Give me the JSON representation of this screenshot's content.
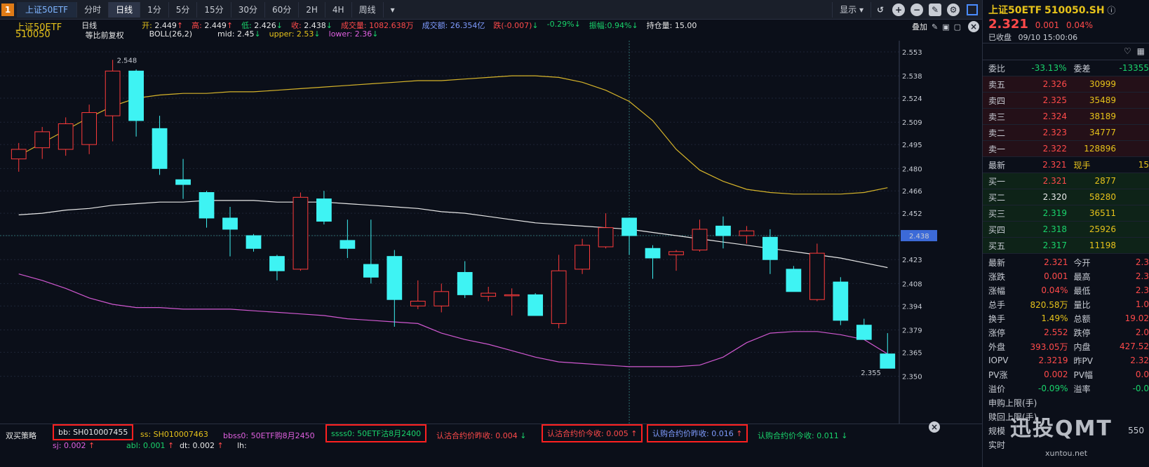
{
  "toolbar": {
    "badge": "1",
    "symbol_tab": "上证50ETF",
    "tabs": [
      "分时",
      "日线",
      "1分",
      "5分",
      "15分",
      "30分",
      "60分",
      "2H",
      "4H",
      "周线"
    ],
    "active_tab": "日线",
    "display_label": "显示"
  },
  "header": {
    "name": "上证50ETF",
    "code": "510050",
    "period": "日线",
    "adjust": "等比前复权",
    "indicator": "BOLL(26,2)",
    "open_label": "开:",
    "open": "2.449",
    "high_label": "高:",
    "high": "2.449",
    "low_label": "低:",
    "low": "2.426",
    "close_label": "收:",
    "close": "2.438",
    "vol_label": "成交量:",
    "vol": "1082.638万",
    "amt_label": "成交额:",
    "amt": "26.354亿",
    "chg_label": "跌(-0.007)",
    "chg_pct": "-0.29%",
    "amp_label": "振幅:0.94%",
    "oi_label": "持仓量:",
    "oi": "15.00",
    "mid_label": "mid:",
    "mid": "2.45",
    "upper_label": "upper:",
    "upper": "2.53",
    "lower_label": "lower:",
    "lower": "2.36",
    "overlay": "叠加"
  },
  "chart_data": {
    "type": "candlestick",
    "ylim": [
      2.345,
      2.56
    ],
    "yticks": [
      "2.553",
      "2.538",
      "2.524",
      "2.509",
      "2.495",
      "2.480",
      "2.466",
      "2.452",
      "2.438",
      "2.423",
      "2.408",
      "2.394",
      "2.379",
      "2.365",
      "2.350"
    ],
    "current_price_tag": "2.438",
    "max_label": "2.548",
    "min_label": "2.355",
    "candles": [
      {
        "o": 2.486,
        "h": 2.496,
        "l": 2.478,
        "c": 2.492
      },
      {
        "o": 2.493,
        "h": 2.506,
        "l": 2.486,
        "c": 2.503
      },
      {
        "o": 2.492,
        "h": 2.512,
        "l": 2.488,
        "c": 2.508
      },
      {
        "o": 2.495,
        "h": 2.52,
        "l": 2.489,
        "c": 2.515
      },
      {
        "o": 2.513,
        "h": 2.548,
        "l": 2.497,
        "c": 2.541
      },
      {
        "o": 2.541,
        "h": 2.542,
        "l": 2.5,
        "c": 2.51
      },
      {
        "o": 2.505,
        "h": 2.513,
        "l": 2.476,
        "c": 2.48
      },
      {
        "o": 2.473,
        "h": 2.486,
        "l": 2.461,
        "c": 2.47
      },
      {
        "o": 2.465,
        "h": 2.466,
        "l": 2.443,
        "c": 2.449
      },
      {
        "o": 2.449,
        "h": 2.456,
        "l": 2.425,
        "c": 2.442
      },
      {
        "o": 2.438,
        "h": 2.439,
        "l": 2.428,
        "c": 2.43
      },
      {
        "o": 2.425,
        "h": 2.426,
        "l": 2.41,
        "c": 2.416
      },
      {
        "o": 2.417,
        "h": 2.465,
        "l": 2.416,
        "c": 2.462
      },
      {
        "o": 2.461,
        "h": 2.466,
        "l": 2.445,
        "c": 2.447
      },
      {
        "o": 2.435,
        "h": 2.448,
        "l": 2.424,
        "c": 2.43
      },
      {
        "o": 2.42,
        "h": 2.448,
        "l": 2.408,
        "c": 2.412
      },
      {
        "o": 2.425,
        "h": 2.429,
        "l": 2.381,
        "c": 2.398
      },
      {
        "o": 2.394,
        "h": 2.41,
        "l": 2.392,
        "c": 2.397
      },
      {
        "o": 2.394,
        "h": 2.408,
        "l": 2.39,
        "c": 2.403
      },
      {
        "o": 2.415,
        "h": 2.422,
        "l": 2.399,
        "c": 2.401
      },
      {
        "o": 2.4,
        "h": 2.406,
        "l": 2.397,
        "c": 2.402
      },
      {
        "o": 2.401,
        "h": 2.405,
        "l": 2.388,
        "c": 2.401
      },
      {
        "o": 2.401,
        "h": 2.402,
        "l": 2.388,
        "c": 2.388
      },
      {
        "o": 2.383,
        "h": 2.426,
        "l": 2.38,
        "c": 2.416
      },
      {
        "o": 2.417,
        "h": 2.436,
        "l": 2.414,
        "c": 2.432
      },
      {
        "o": 2.431,
        "h": 2.452,
        "l": 2.43,
        "c": 2.443
      },
      {
        "o": 2.449,
        "h": 2.449,
        "l": 2.426,
        "c": 2.438
      },
      {
        "o": 2.43,
        "h": 2.432,
        "l": 2.411,
        "c": 2.424
      },
      {
        "o": 2.426,
        "h": 2.429,
        "l": 2.416,
        "c": 2.428
      },
      {
        "o": 2.429,
        "h": 2.448,
        "l": 2.428,
        "c": 2.442
      },
      {
        "o": 2.444,
        "h": 2.45,
        "l": 2.43,
        "c": 2.438
      },
      {
        "o": 2.438,
        "h": 2.444,
        "l": 2.433,
        "c": 2.441
      },
      {
        "o": 2.437,
        "h": 2.442,
        "l": 2.414,
        "c": 2.423
      },
      {
        "o": 2.417,
        "h": 2.419,
        "l": 2.403,
        "c": 2.403
      },
      {
        "o": 2.398,
        "h": 2.433,
        "l": 2.397,
        "c": 2.427
      },
      {
        "o": 2.409,
        "h": 2.412,
        "l": 2.382,
        "c": 2.385
      },
      {
        "o": 2.382,
        "h": 2.386,
        "l": 2.373,
        "c": 2.373
      },
      {
        "o": 2.364,
        "h": 2.377,
        "l": 2.355,
        "c": 2.355
      }
    ],
    "mid": [
      2.451,
      2.452,
      2.454,
      2.455,
      2.457,
      2.458,
      2.459,
      2.459,
      2.46,
      2.46,
      2.46,
      2.459,
      2.459,
      2.459,
      2.458,
      2.457,
      2.456,
      2.455,
      2.453,
      2.452,
      2.45,
      2.448,
      2.446,
      2.445,
      2.444,
      2.443,
      2.442,
      2.44,
      2.438,
      2.436,
      2.434,
      2.432,
      2.43,
      2.428,
      2.426,
      2.424,
      2.421,
      2.418
    ],
    "upper": [
      2.488,
      2.496,
      2.504,
      2.512,
      2.519,
      2.524,
      2.526,
      2.527,
      2.527,
      2.528,
      2.528,
      2.529,
      2.53,
      2.531,
      2.532,
      2.533,
      2.534,
      2.535,
      2.535,
      2.536,
      2.537,
      2.538,
      2.538,
      2.537,
      2.534,
      2.529,
      2.522,
      2.51,
      2.492,
      2.479,
      2.472,
      2.467,
      2.465,
      2.464,
      2.464,
      2.464,
      2.465,
      2.468
    ],
    "lower": [
      2.414,
      2.41,
      2.405,
      2.399,
      2.395,
      2.393,
      2.393,
      2.392,
      2.392,
      2.392,
      2.391,
      2.39,
      2.389,
      2.388,
      2.386,
      2.385,
      2.384,
      2.383,
      2.377,
      2.373,
      2.37,
      2.366,
      2.362,
      2.359,
      2.358,
      2.357,
      2.356,
      2.356,
      2.356,
      2.357,
      2.362,
      2.371,
      2.377,
      2.378,
      2.378,
      2.376,
      2.373,
      2.364
    ]
  },
  "strategy": {
    "title": "双买策略",
    "bb": "bb: SH010007455",
    "ss": "ss: SH010007463",
    "bbss0": "bbss0: 50ETF购8月2450",
    "ssss0": "ssss0: 50ETF沽8月2400",
    "put_prev": "认沽合约价昨收: 0.004",
    "put_now": "认沽合约价今收: 0.005",
    "call_prev": "认购合约价昨收: 0.016",
    "call_now": "认购合约价今收: 0.011",
    "sj": "sj: 0.002",
    "abl": "abl: 0.001",
    "dt": "dt: 0.002",
    "lh": "lh:"
  },
  "panel": {
    "title": "上证50ETF",
    "code": "510050.SH",
    "price": "2.321",
    "chg": "0.001",
    "chg_pct": "0.04%",
    "status": "已收盘",
    "datetime": "09/10  15:00:06",
    "weibi_label": "委比",
    "weibi": "-33.13%",
    "weicha_label": "委差",
    "weicha": "-13355",
    "asks": [
      {
        "label": "卖五",
        "price": "2.326",
        "vol": "30999"
      },
      {
        "label": "卖四",
        "price": "2.325",
        "vol": "35489"
      },
      {
        "label": "卖三",
        "price": "2.324",
        "vol": "38189"
      },
      {
        "label": "卖二",
        "price": "2.323",
        "vol": "34777"
      },
      {
        "label": "卖一",
        "price": "2.322",
        "vol": "128896"
      }
    ],
    "latest_label": "最新",
    "latest": "2.321",
    "xianshou_label": "现手",
    "xianshou": "15",
    "bids": [
      {
        "label": "买一",
        "price": "2.321",
        "vol": "2877"
      },
      {
        "label": "买二",
        "price": "2.320",
        "vol": "58280"
      },
      {
        "label": "买三",
        "price": "2.319",
        "vol": "36511"
      },
      {
        "label": "买四",
        "price": "2.318",
        "vol": "25926"
      },
      {
        "label": "买五",
        "price": "2.317",
        "vol": "11198"
      }
    ],
    "stats": [
      {
        "a": "最新",
        "b": "2.321",
        "c": "今开",
        "d": "2.3"
      },
      {
        "a": "涨跌",
        "b": "0.001",
        "c": "最高",
        "d": "2.3"
      },
      {
        "a": "涨幅",
        "b": "0.04%",
        "c": "最低",
        "d": "2.3"
      },
      {
        "a": "总手",
        "b": "820.58万",
        "c": "量比",
        "d": "1.0"
      },
      {
        "a": "换手",
        "b": "1.49%",
        "c": "总额",
        "d": "19.02"
      },
      {
        "a": "涨停",
        "b": "2.552",
        "c": "跌停",
        "d": "2.0"
      },
      {
        "a": "外盘",
        "b": "393.05万",
        "c": "内盘",
        "d": "427.52"
      },
      {
        "a": "IOPV",
        "b": "2.3219",
        "c": "昨PV",
        "d": "2.32"
      },
      {
        "a": "PV涨",
        "b": "0.002",
        "c": "PV幅",
        "d": "0.0"
      },
      {
        "a": "溢价",
        "b": "-0.09%",
        "c": "溢率",
        "d": "-0.0"
      }
    ],
    "limit_buy": "申购上限(手)",
    "limit_redeem": "赎回上限(手)",
    "scale_label": "规模",
    "scale": "550",
    "realtime": "实时"
  },
  "watermark": {
    "brand": "迅投QMT",
    "site": "xuntou.net"
  }
}
